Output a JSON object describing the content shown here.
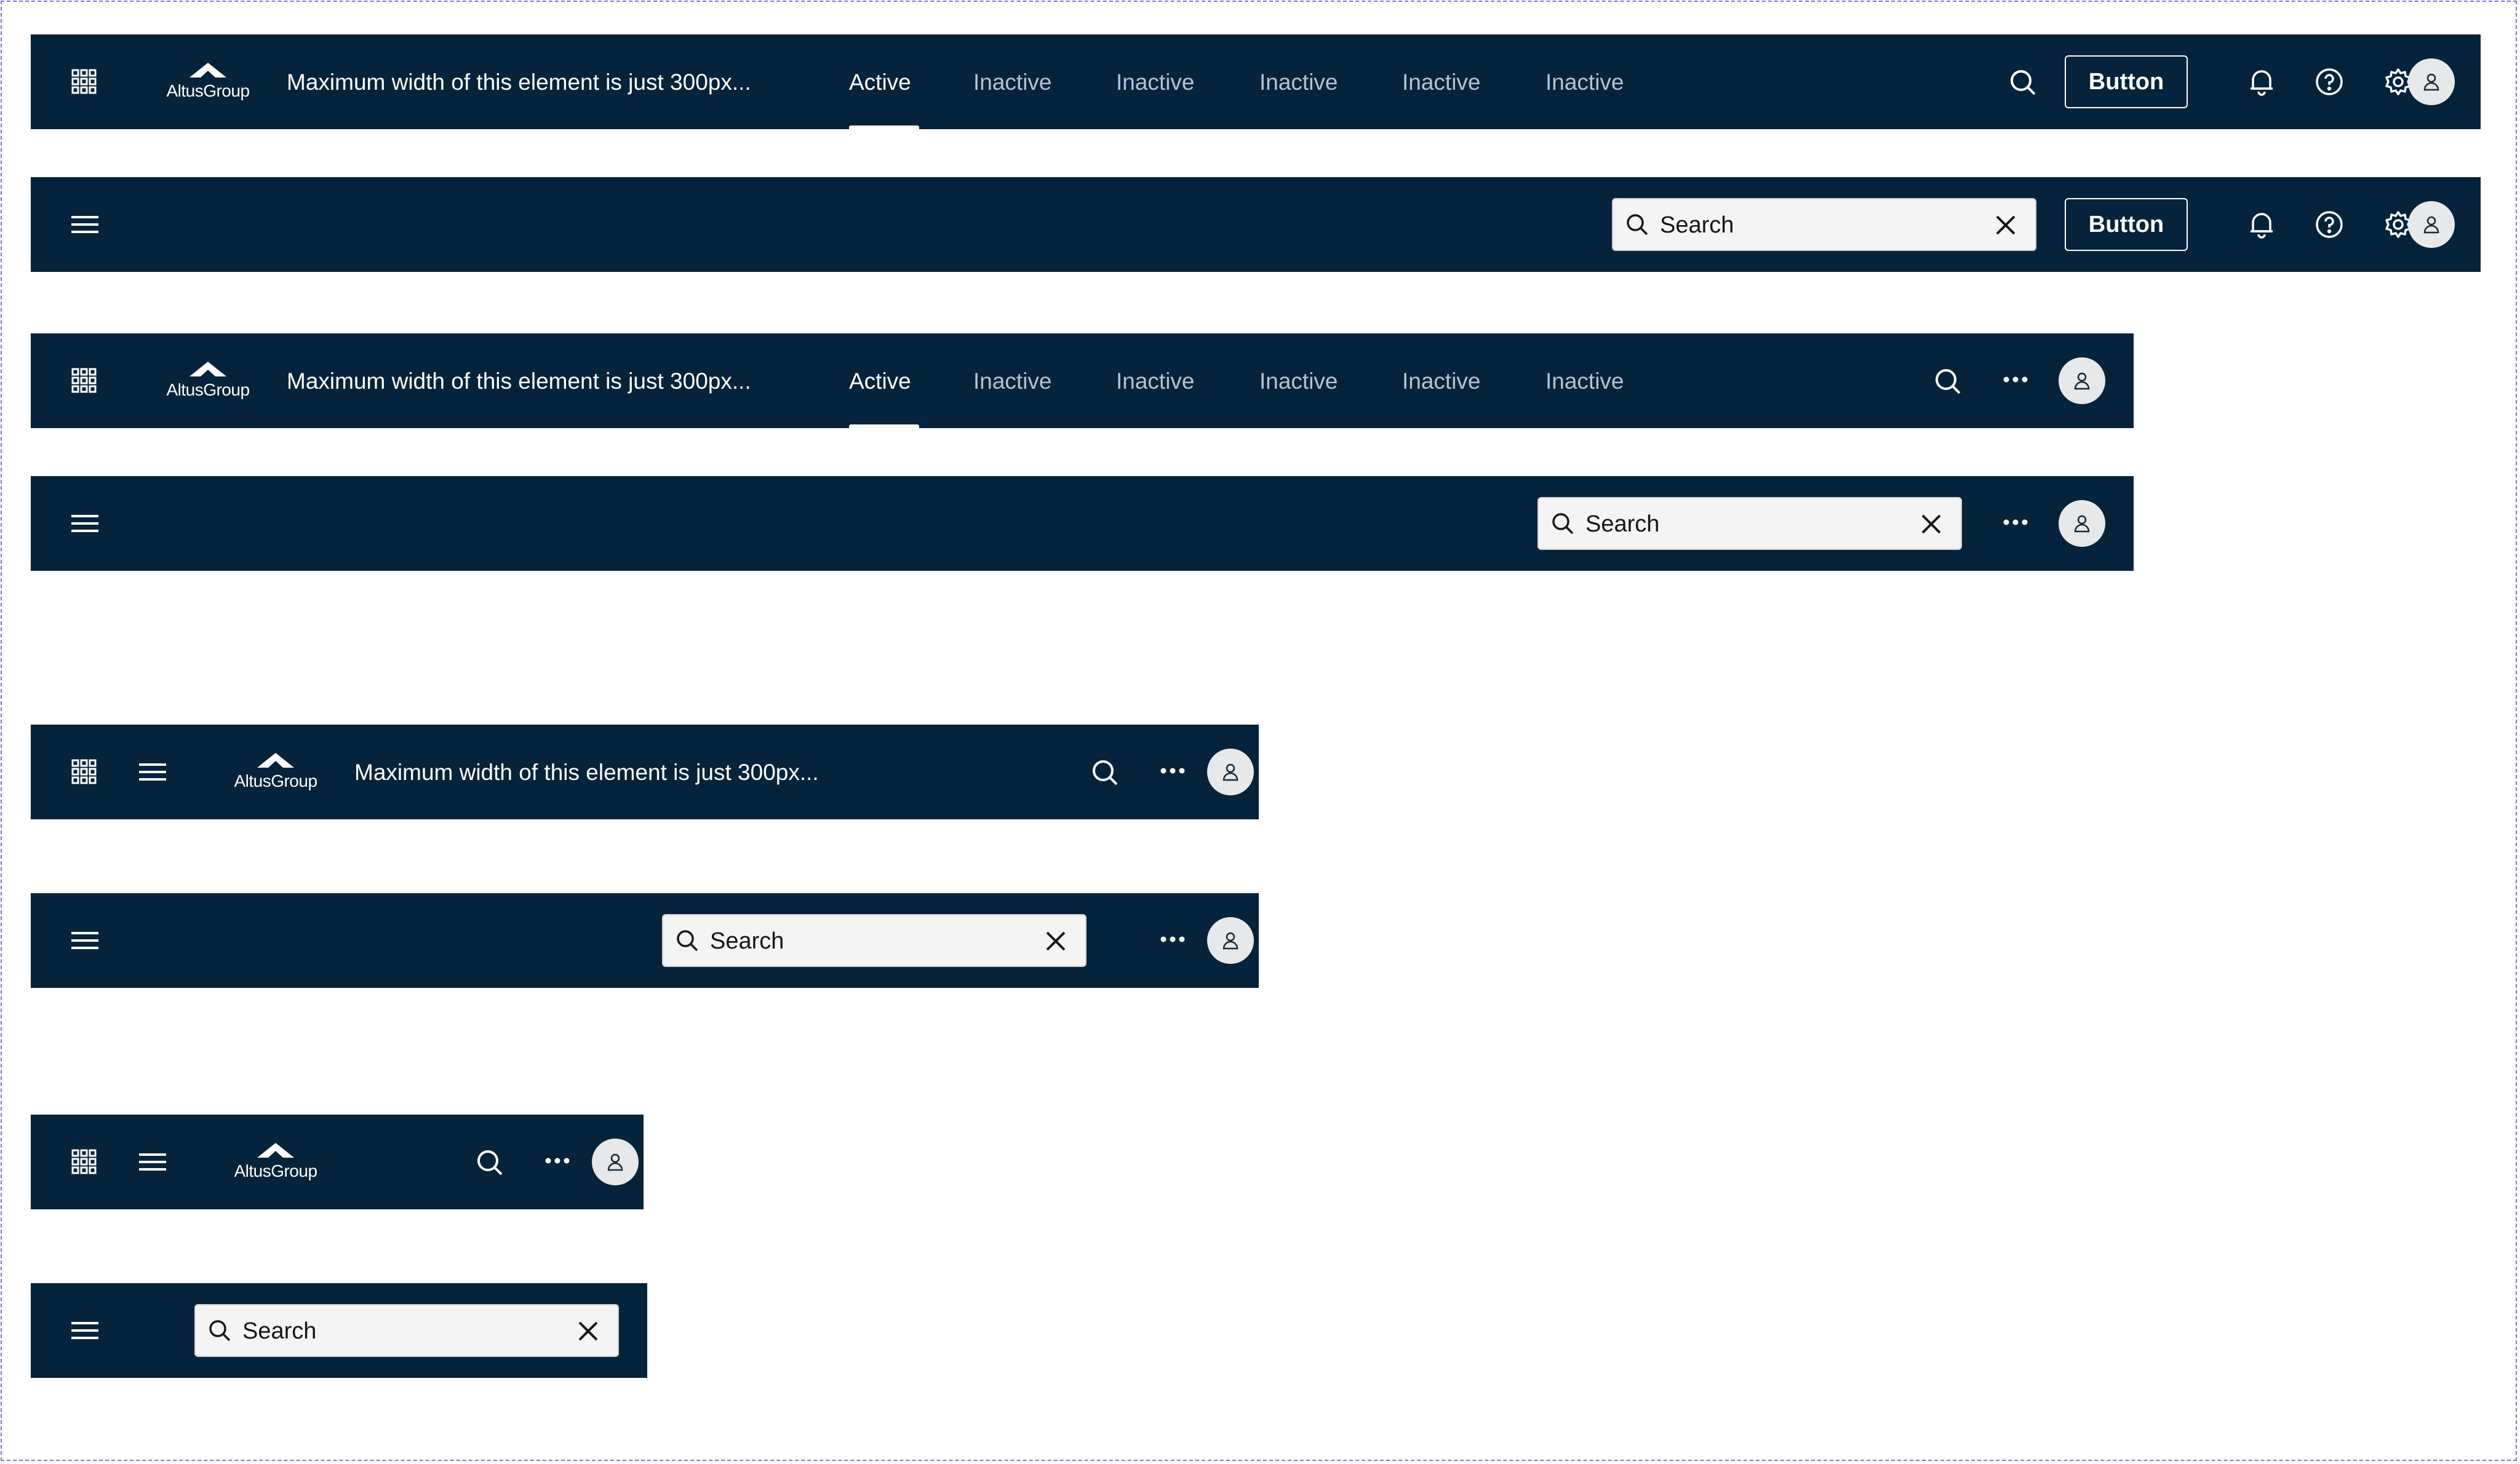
{
  "logo": {
    "text": "AltusGroup"
  },
  "title": "Maximum width of this element is just 300px...",
  "tabs": [
    {
      "label": "Active",
      "active": true
    },
    {
      "label": "Inactive",
      "active": false
    },
    {
      "label": "Inactive",
      "active": false
    },
    {
      "label": "Inactive",
      "active": false
    },
    {
      "label": "Inactive",
      "active": false
    },
    {
      "label": "Inactive",
      "active": false
    }
  ],
  "button": {
    "label": "Button"
  },
  "search": {
    "value": "Search"
  },
  "icons": {
    "apps": "apps-grid-icon",
    "menu": "hamburger-menu-icon",
    "search": "search-icon",
    "notifications": "bell-icon",
    "help": "help-icon",
    "settings": "gear-icon",
    "more": "overflow-menu-icon",
    "user": "user-icon",
    "clear": "close-icon"
  },
  "colors": {
    "header_bg": "#05233b",
    "tab_inactive": "#b6c2cc",
    "avatar_bg": "#e6e8ea",
    "search_bg": "#f4f4f4",
    "frame_border": "#8a6cf0"
  }
}
